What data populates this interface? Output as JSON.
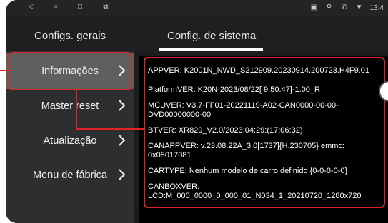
{
  "status_bar": {
    "left_icons": [
      "back-icon",
      "home-icon",
      "recent-apps-icon",
      "screen-mirror-icon"
    ],
    "right_icons": [
      "sim-icon",
      "location-icon",
      "phone-icon",
      "wifi-icon"
    ],
    "time": "13:4"
  },
  "tabs": [
    {
      "label": "Configs. gerais"
    },
    {
      "label": "Config. de sistema"
    }
  ],
  "sidebar": {
    "items": [
      {
        "label": "Informações"
      },
      {
        "label": "Master reset"
      },
      {
        "label": "Atualização"
      },
      {
        "label": "Menu de fábrica"
      }
    ]
  },
  "info": {
    "lines": [
      "APPVER: K2001N_NWD_S212909.20230914.200723.H4F9.01",
      "PlatformVER: K20N-2023/08/22[ 9:50:47]-1.00_R",
      "MCUVER: V3.7-FF01-20221119-A02-CAN0000-00-00-",
      "DVD00000000-00",
      "BTVER: XR829_V2.0/2023:04:29:(17:06:32)",
      "CANAPPVER: v.23.08.22A_3.0[1737]{H.230705}  emmc:",
      "0x05017081",
      "CARTYPE: Nenhum modelo de carro definido  {0-0-0-0-0}",
      "CANBOXVER:",
      "LCD:M_000_0000_0_000_01_N034_1_20210720_1280x720"
    ]
  },
  "colors": {
    "callout": "#e0222b",
    "active_item": "#5f605e"
  }
}
